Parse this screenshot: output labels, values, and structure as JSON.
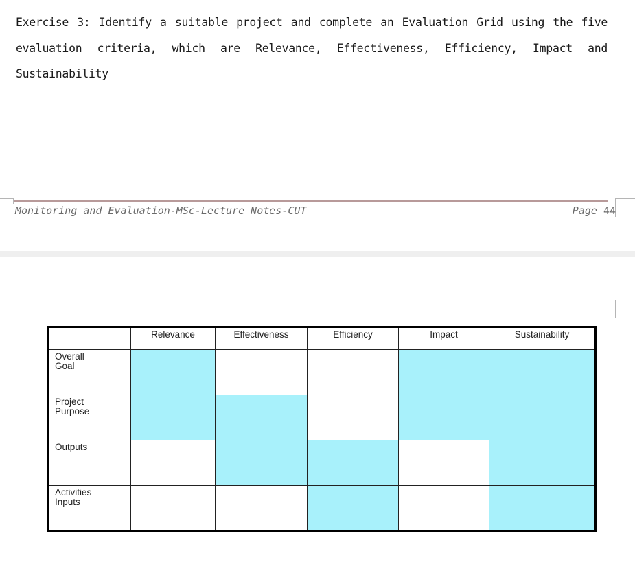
{
  "page1": {
    "body_text": "Exercise 3: Identify a suitable project and complete an Evaluation Grid using the five evaluation criteria, which are Relevance, Effectiveness, Efficiency, Impact and Sustainability",
    "footer": {
      "left": "Monitoring and Evaluation-MSc-Lecture Notes-CUT",
      "page_label": "Page",
      "page_number": "44",
      "rule_color": "#b89a9a"
    }
  },
  "grid": {
    "fill_color": "#a8f1fb",
    "columns": [
      "",
      "Relevance",
      "Effectiveness",
      "Efficiency",
      "Impact",
      "Sustainability"
    ],
    "rows": [
      {
        "label": "Overall Goal",
        "label_lines": [
          "Overall",
          "Goal"
        ],
        "filled": [
          true,
          false,
          false,
          true,
          true
        ]
      },
      {
        "label": "Project Purpose",
        "label_lines": [
          "Project",
          "Purpose"
        ],
        "filled": [
          true,
          true,
          false,
          true,
          true
        ]
      },
      {
        "label": "Outputs",
        "label_lines": [
          "Outputs"
        ],
        "filled": [
          false,
          true,
          true,
          false,
          true
        ]
      },
      {
        "label": "Activities Inputs",
        "label_lines": [
          "Activities",
          "Inputs"
        ],
        "filled": [
          false,
          false,
          true,
          false,
          true
        ]
      }
    ]
  }
}
